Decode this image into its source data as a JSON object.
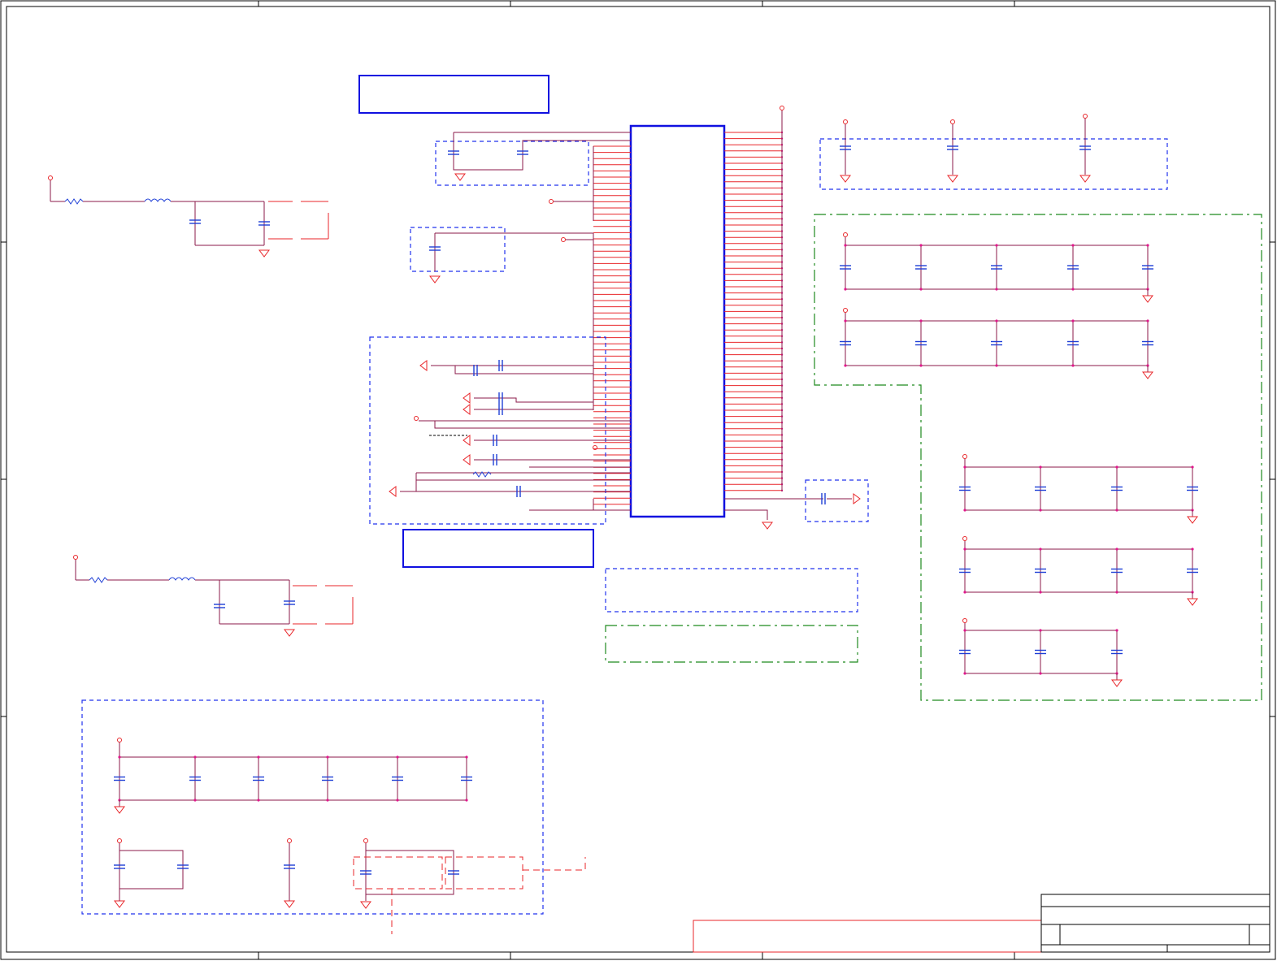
{
  "sheet": {
    "title": "",
    "colors": {
      "wire": "#e8262a",
      "net": "#8b1a4a",
      "component": "#1f3fd6",
      "block": "#1010e0",
      "group_blue": "#2233ee",
      "group_green": "#1f8a1f",
      "junction": "#e0188c",
      "border": "#000000"
    }
  },
  "components": {
    "main_ic": "ic-block",
    "capacitor_icon": "capacitor-icon",
    "resistor_icon": "resistor-icon",
    "inductor_icon": "inductor-icon",
    "ground_icon": "ground-icon",
    "power_icon": "power-port-icon"
  },
  "title_block": {
    "text": ""
  }
}
